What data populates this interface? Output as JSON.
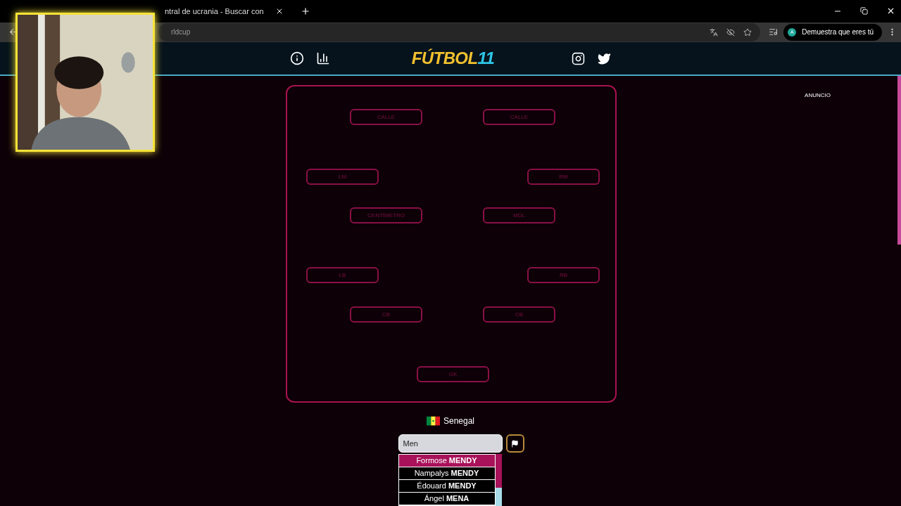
{
  "browser": {
    "tabs": [
      {
        "label": "ntral de ucrania - Buscar con",
        "selected": false
      }
    ],
    "address": "rldcup",
    "profile_button": "Demuestra que eres tú",
    "profile_initial": "A"
  },
  "header": {
    "logo_main": "FÚTBOL",
    "logo_accent": "11"
  },
  "ad_label": "ANUNCIO",
  "pitch": {
    "positions": [
      {
        "label": "CALLE"
      },
      {
        "label": "CALLE"
      },
      {
        "label": "LM"
      },
      {
        "label": "RM"
      },
      {
        "label": "CENTÍMETRO"
      },
      {
        "label": "MDL"
      },
      {
        "label": "LB"
      },
      {
        "label": "RB"
      },
      {
        "label": "CB"
      },
      {
        "label": "CB"
      },
      {
        "label": "GK"
      }
    ]
  },
  "team": {
    "name": "Senegal"
  },
  "search": {
    "value": "Men"
  },
  "suggestions": [
    {
      "label": "Formose **MENDY**",
      "selected": true
    },
    {
      "label": "Nampalys **MENDY**",
      "selected": false
    },
    {
      "label": "Édouard **MENDY**",
      "selected": false
    },
    {
      "label": "Ángel **MENA**",
      "selected": false
    }
  ]
}
